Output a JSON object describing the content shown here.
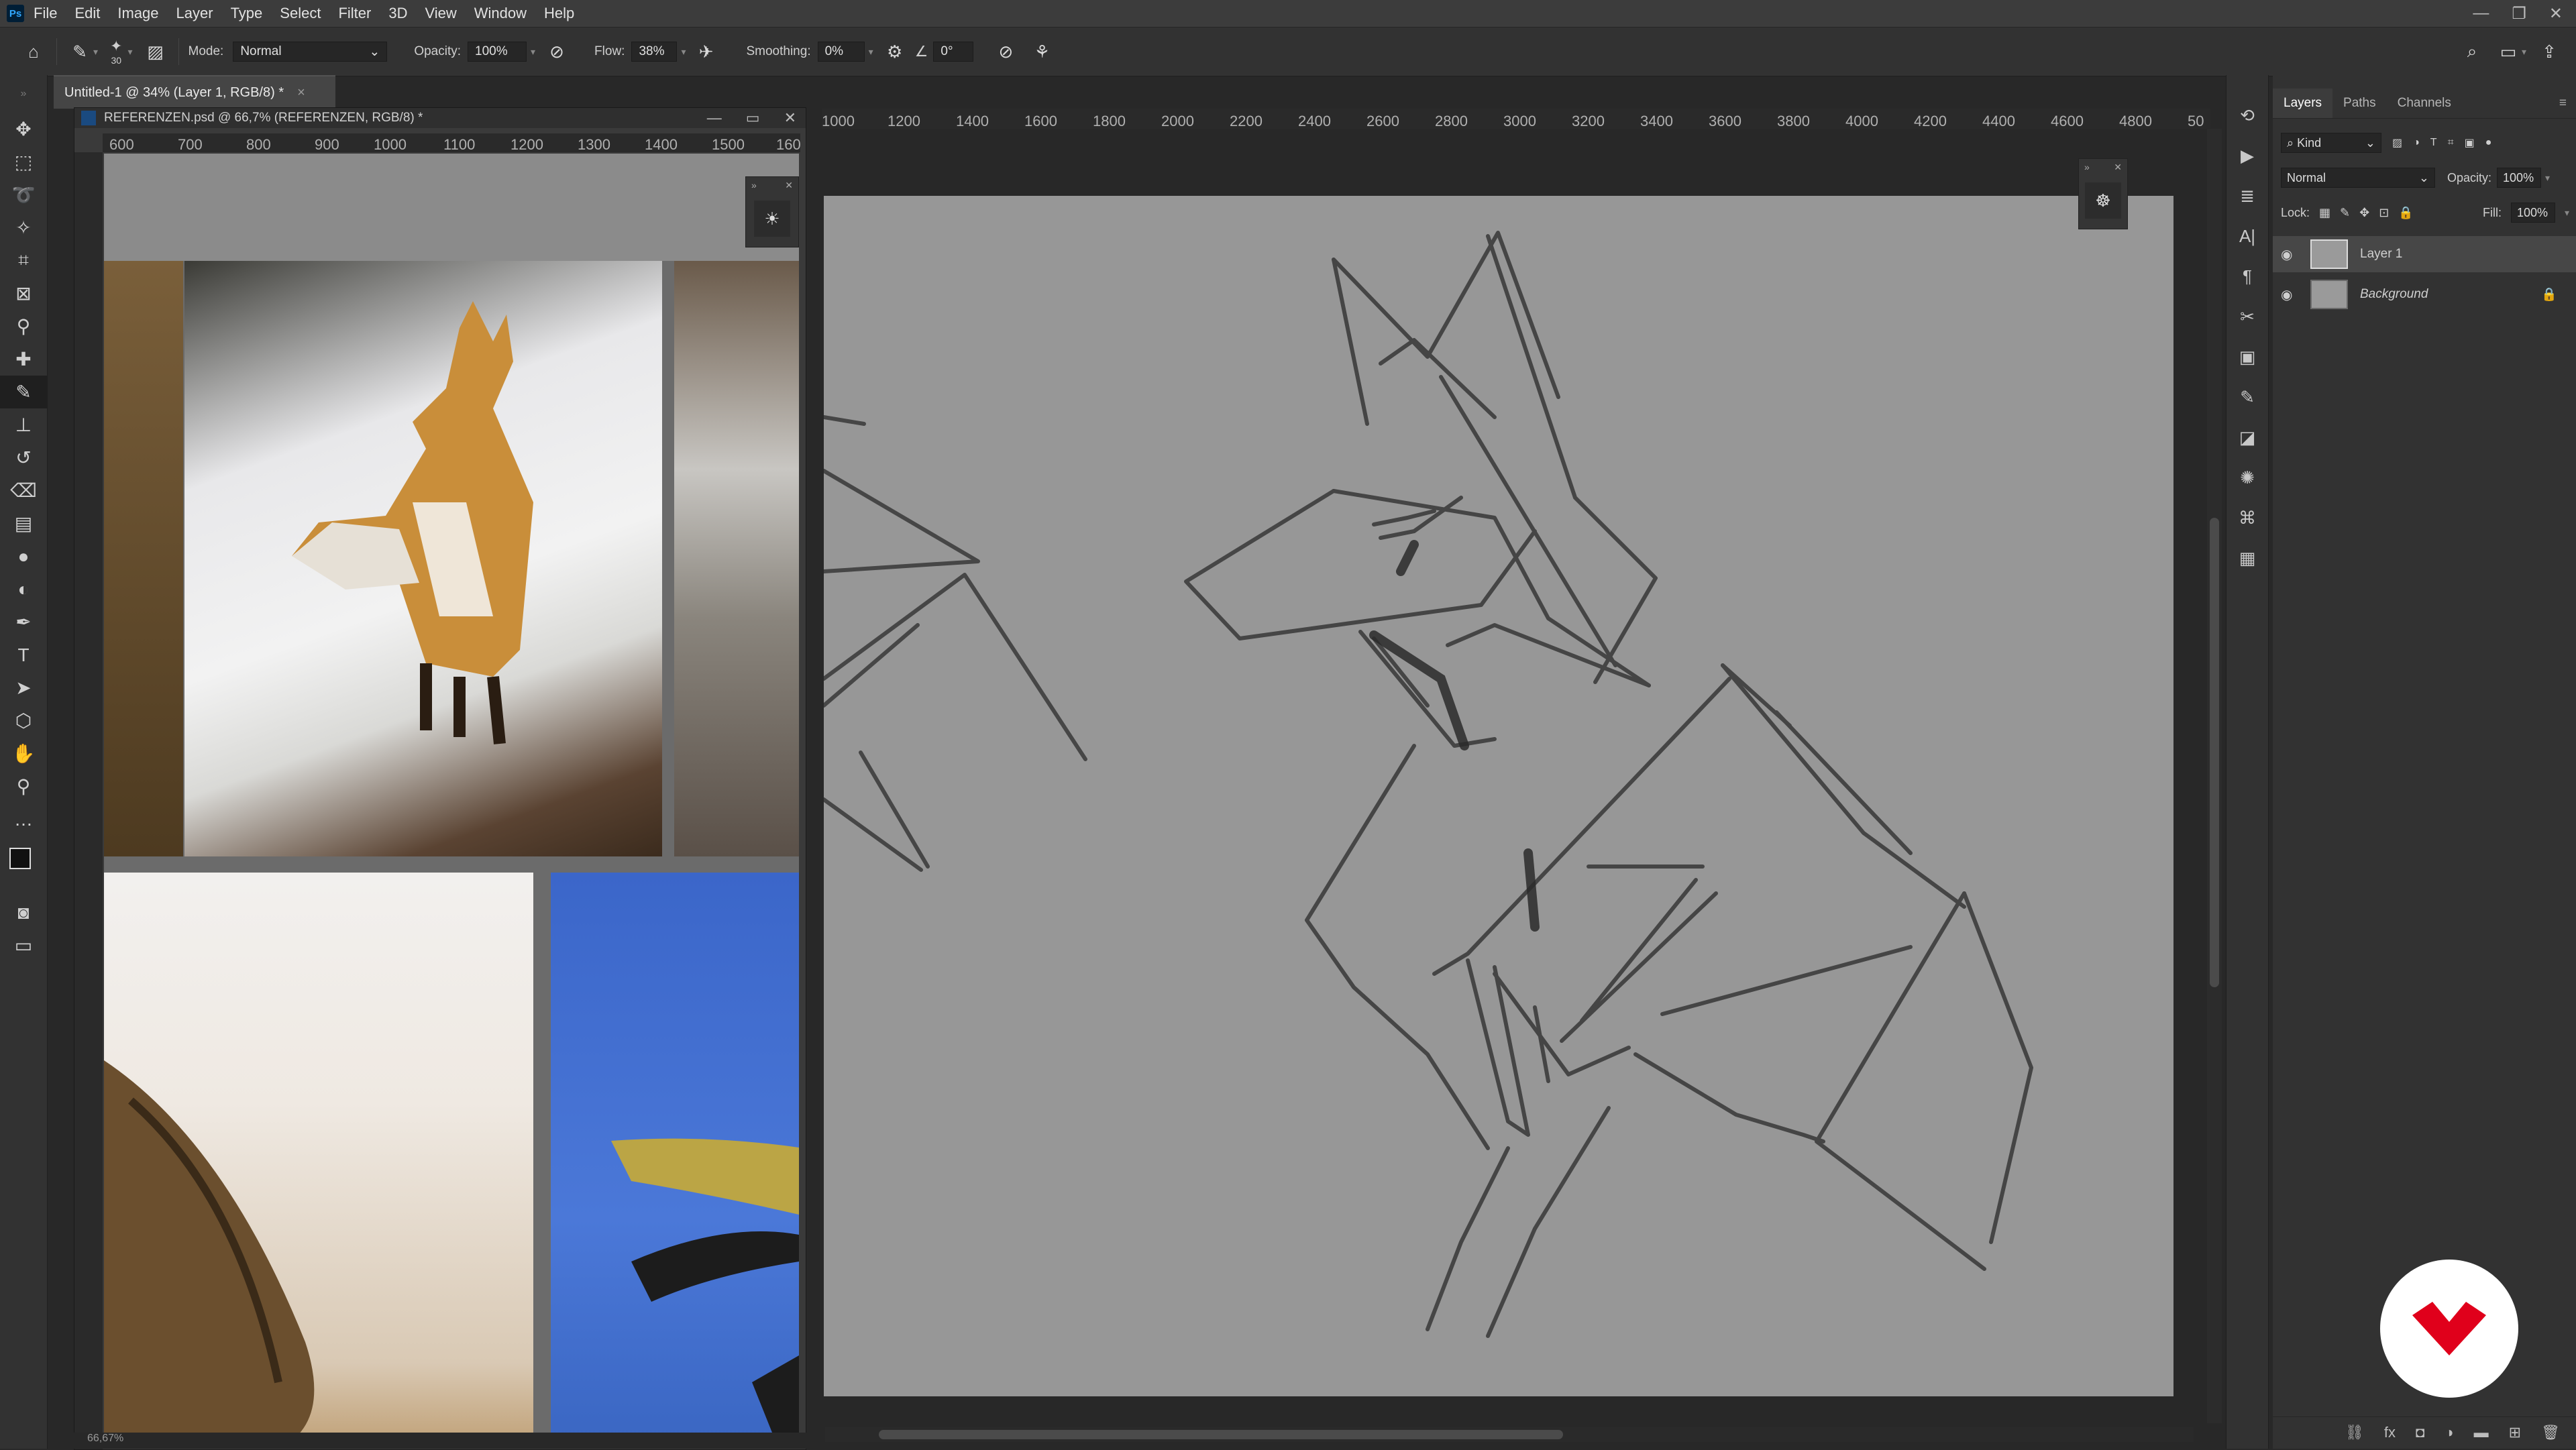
{
  "app": {
    "logo": "Ps"
  },
  "menu": [
    "File",
    "Edit",
    "Image",
    "Layer",
    "Type",
    "Select",
    "Filter",
    "3D",
    "View",
    "Window",
    "Help"
  ],
  "options": {
    "brush_size": "30",
    "mode_label": "Mode:",
    "mode_value": "Normal",
    "opacity_label": "Opacity:",
    "opacity_value": "100%",
    "flow_label": "Flow:",
    "flow_value": "38%",
    "smoothing_label": "Smoothing:",
    "smoothing_value": "0%",
    "angle_value": "0°"
  },
  "document": {
    "tab_title": "Untitled-1 @ 34% (Layer 1, RGB/8) *",
    "ruler_ticks": [
      "1000",
      "1200",
      "1400",
      "1600",
      "1800",
      "2000",
      "2200",
      "2400",
      "2600",
      "2800",
      "3000",
      "3200",
      "3400",
      "3600",
      "3800",
      "4000",
      "4200",
      "4400",
      "4600",
      "4800",
      "50"
    ]
  },
  "reference_window": {
    "title": "REFERENZEN.psd @ 66,7% (REFERENZEN, RGB/8) *",
    "ruler_ticks": [
      "600",
      "700",
      "800",
      "900",
      "1000",
      "1100",
      "1200",
      "1300",
      "1400",
      "1500",
      "160"
    ],
    "status": "66,67%"
  },
  "layers_panel": {
    "tabs": [
      "Layers",
      "Paths",
      "Channels"
    ],
    "filter_kind": "Kind",
    "blend_mode": "Normal",
    "opacity_label": "Opacity:",
    "opacity_value": "100%",
    "lock_label": "Lock:",
    "fill_label": "Fill:",
    "fill_value": "100%",
    "layers": [
      {
        "name": "Layer 1",
        "selected": true
      },
      {
        "name": "Background",
        "selected": false,
        "locked": true
      }
    ]
  },
  "tools": [
    "move-icon",
    "marquee-icon",
    "lasso-icon",
    "magic-wand-icon",
    "crop-icon",
    "frame-icon",
    "eyedropper-icon",
    "healing-icon",
    "brush-icon",
    "stamp-icon",
    "history-brush-icon",
    "eraser-icon",
    "gradient-icon",
    "blur-icon",
    "dodge-icon",
    "pen-icon",
    "type-icon",
    "path-select-icon",
    "shape-icon",
    "hand-icon",
    "zoom-icon",
    "more-icon"
  ],
  "colors": {
    "accent": "#31a8ff",
    "brand": "#e0001b"
  }
}
